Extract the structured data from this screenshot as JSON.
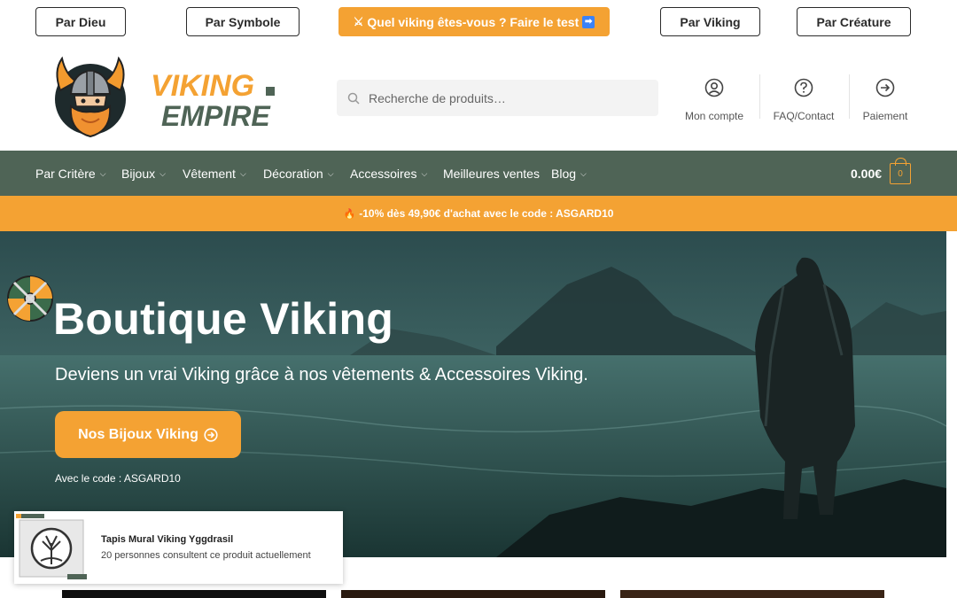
{
  "top_nav": {
    "by_god": "Par Dieu",
    "by_symbol": "Par Symbole",
    "quiz": "Quel viking êtes-vous ? Faire le test",
    "by_viking": "Par Viking",
    "by_creature": "Par Créature"
  },
  "header": {
    "logo_line1": "VIKING",
    "logo_line2": "EMPIRE",
    "search_placeholder": "Recherche de produits…",
    "account": "Mon compte",
    "faq": "FAQ/Contact",
    "payment": "Paiement"
  },
  "nav": {
    "items": [
      "Par Critère",
      "Bijoux",
      "Vêtement",
      "Décoration",
      "Accessoires",
      "Meilleures ventes",
      "Blog"
    ],
    "cart_total": "0.00€",
    "cart_count": "0"
  },
  "promo": {
    "text": "-10% dès 49,90€ d'achat avec le code : ASGARD10"
  },
  "hero": {
    "title": "Boutique Viking",
    "subtitle": "Deviens un vrai Viking grâce à nos vêtements & Accessoires Viking.",
    "button": "Nos Bijoux Viking",
    "code_note": "Avec le code : ASGARD10"
  },
  "popup": {
    "product": "Tapis Mural Viking Yggdrasil",
    "viewers": "20 personnes consultent ce produit actuellement"
  },
  "colors": {
    "accent": "#f4a233",
    "nav_bg": "#4f6456",
    "hero_dark": "#1c3a3c"
  },
  "icons": {
    "search": "search-icon",
    "account": "user-circle-icon",
    "faq": "question-circle-icon",
    "payment": "arrow-circle-right-icon",
    "cart": "shopping-bag-icon"
  }
}
